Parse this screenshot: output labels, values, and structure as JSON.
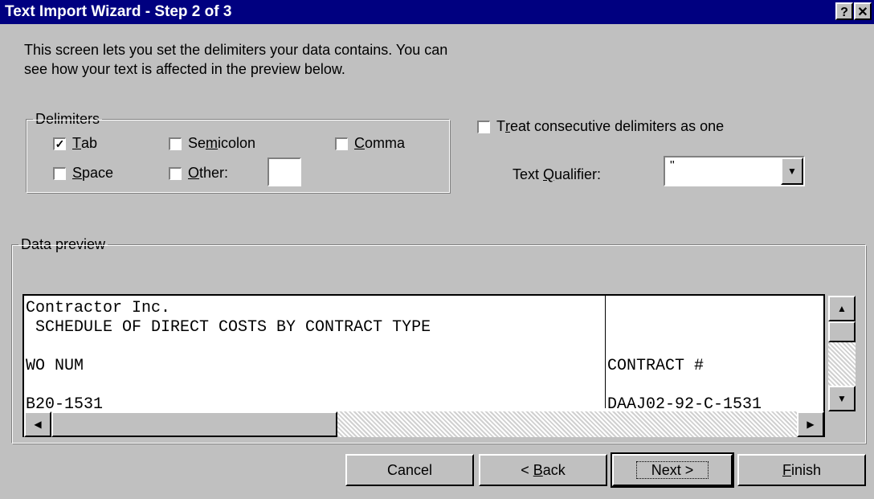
{
  "window": {
    "title": "Text Import Wizard - Step 2 of 3",
    "help_btn": "?",
    "close_btn": "✕"
  },
  "description": {
    "line1": "This screen lets you set the delimiters your data contains.  You can",
    "line2": "see how your text is affected in the preview below."
  },
  "delimiters": {
    "legend": "Delimiters",
    "tab": {
      "pre": "",
      "key": "T",
      "post": "ab",
      "checked": true
    },
    "semicolon": {
      "pre": "Se",
      "key": "m",
      "post": "icolon",
      "checked": false
    },
    "comma": {
      "pre": "",
      "key": "C",
      "post": "omma",
      "checked": false
    },
    "space": {
      "pre": "",
      "key": "S",
      "post": "pace",
      "checked": false
    },
    "other": {
      "pre": "",
      "key": "O",
      "post": "ther:",
      "checked": false
    },
    "other_value": ""
  },
  "consecutive": {
    "pre": "T",
    "key": "r",
    "post": "eat consecutive delimiters as one",
    "checked": false
  },
  "qualifier": {
    "label_pre": "Text ",
    "label_key": "Q",
    "label_post": "ualifier:",
    "value": "\""
  },
  "preview": {
    "legend": "Data preview",
    "rows": [
      [
        "Contractor Inc.",
        ""
      ],
      [
        " SCHEDULE OF DIRECT COSTS BY CONTRACT TYPE",
        ""
      ],
      [
        "",
        ""
      ],
      [
        "WO NUM",
        "CONTRACT #"
      ],
      [
        "",
        ""
      ],
      [
        "B20-1531",
        "DAAJ02-92-C-1531"
      ]
    ]
  },
  "buttons": {
    "cancel": "Cancel",
    "back_pre": "< ",
    "back_key": "B",
    "back_post": "ack",
    "next": "Next >",
    "finish_key": "F",
    "finish_post": "inish"
  }
}
